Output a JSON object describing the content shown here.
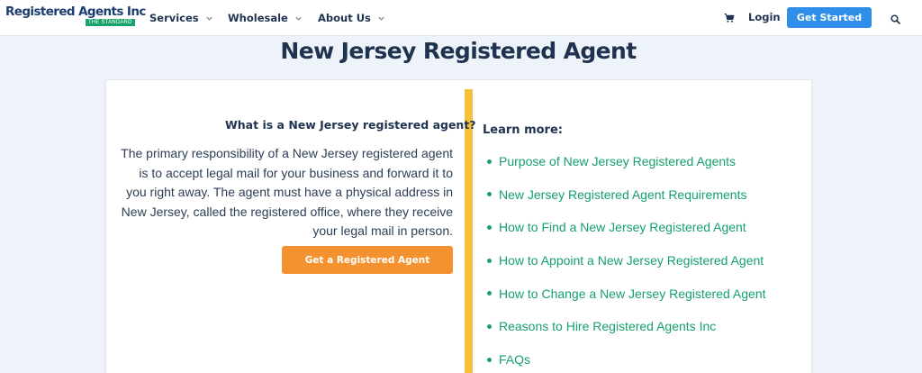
{
  "header": {
    "logo": {
      "name": "Registered Agents Inc",
      "tagline": "THE STANDARD"
    },
    "nav": [
      {
        "label": "Services"
      },
      {
        "label": "Wholesale"
      },
      {
        "label": "About Us"
      }
    ],
    "login_label": "Login",
    "get_started_label": "Get Started",
    "icons": {
      "cart": "cart-icon",
      "search": "search-icon",
      "chevron": "chevron-down-icon"
    }
  },
  "page": {
    "title": "New Jersey Registered Agent"
  },
  "left": {
    "heading": "What is a New Jersey registered agent?",
    "body": "The primary responsibility of a New Jersey registered agent is to accept legal mail for your business and forward it to you right away. The agent must have a physical address in New Jersey, called the registered office, where they receive your legal mail in person.",
    "cta_label": "Get a Registered Agent"
  },
  "right": {
    "heading": "Learn more:",
    "links": [
      "Purpose of New Jersey Registered Agents",
      "New Jersey Registered Agent Requirements",
      "How to Find a New Jersey Registered Agent",
      "How to Appoint a New Jersey Registered Agent",
      "How to Change a New Jersey Registered Agent",
      "Reasons to Hire Registered Agents Inc",
      "FAQs"
    ]
  },
  "colors": {
    "navy": "#1f3350",
    "link_green": "#16a06b",
    "cta_orange": "#f4922f",
    "button_blue": "#2f8fe8",
    "divider_yellow": "#f5c13b",
    "background": "#eef3f9"
  }
}
